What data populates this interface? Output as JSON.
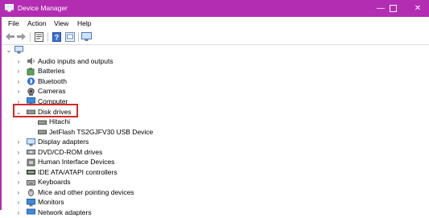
{
  "window": {
    "title": "Device Manager",
    "accent": "#b32db3",
    "controls": {
      "minimize": "—",
      "maximize": "☐",
      "close": "✕"
    }
  },
  "menu": [
    "File",
    "Action",
    "View",
    "Help"
  ],
  "toolbar": [
    "back-arrow-icon",
    "forward-arrow-icon",
    "properties-icon",
    "help-icon",
    "update-icon",
    "monitor-icon"
  ],
  "tree": {
    "root_icon": "computer-icon",
    "items": [
      {
        "label": "Audio inputs and outputs",
        "icon": "speaker-icon",
        "state": "collapsed"
      },
      {
        "label": "Batteries",
        "icon": "battery-icon",
        "state": "collapsed"
      },
      {
        "label": "Bluetooth",
        "icon": "bluetooth-icon",
        "state": "collapsed"
      },
      {
        "label": "Cameras",
        "icon": "camera-icon",
        "state": "collapsed"
      },
      {
        "label": "Computer",
        "icon": "computer-icon",
        "state": "collapsed"
      },
      {
        "label": "Disk drives",
        "icon": "disk-drive-icon",
        "state": "expanded",
        "highlight": true,
        "children": [
          {
            "label": "Hitachi",
            "icon": "disk-drive-icon"
          },
          {
            "label": "JetFlash TS2GJFV30 USB Device",
            "icon": "disk-drive-icon"
          }
        ]
      },
      {
        "label": "Display adapters",
        "icon": "display-adapter-icon",
        "state": "collapsed"
      },
      {
        "label": "DVD/CD-ROM drives",
        "icon": "dvd-drive-icon",
        "state": "collapsed"
      },
      {
        "label": "Human Interface Devices",
        "icon": "hid-icon",
        "state": "collapsed"
      },
      {
        "label": "IDE ATA/ATAPI controllers",
        "icon": "ide-controller-icon",
        "state": "collapsed"
      },
      {
        "label": "Keyboards",
        "icon": "keyboard-icon",
        "state": "collapsed"
      },
      {
        "label": "Mice and other pointing devices",
        "icon": "mouse-icon",
        "state": "collapsed"
      },
      {
        "label": "Monitors",
        "icon": "monitor-icon",
        "state": "collapsed"
      },
      {
        "label": "Network adapters",
        "icon": "network-icon",
        "state": "collapsed"
      }
    ]
  },
  "highlight_color": "#d42a2a"
}
